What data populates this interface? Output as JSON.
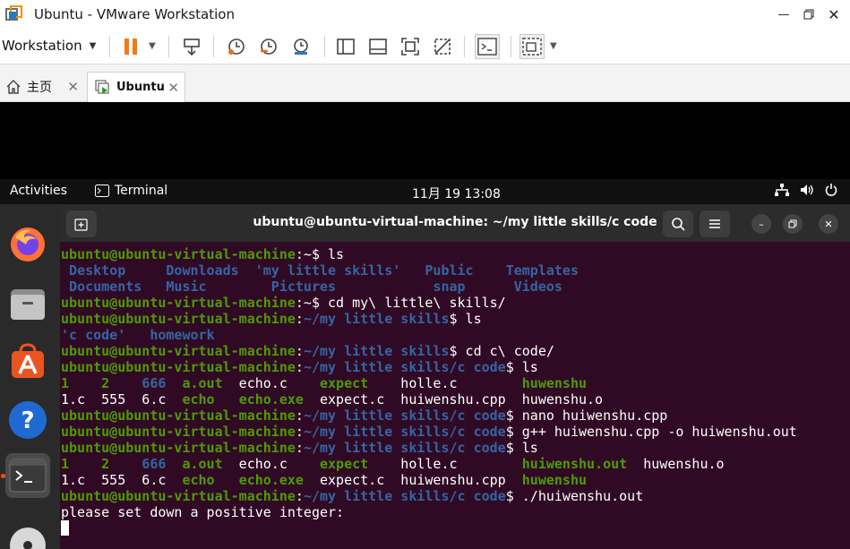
{
  "window": {
    "title": "Ubuntu - VMware Workstation"
  },
  "toolbar": {
    "menu_label": "Workstation"
  },
  "tabs": {
    "home_label": "主页",
    "vm_label": "Ubuntu"
  },
  "gnome": {
    "activities": "Activities",
    "app_name": "Terminal",
    "clock": "11月 19  13:08"
  },
  "terminal": {
    "title": "ubuntu@ubuntu-virtual-machine: ~/my little skills/c code",
    "prompt_user": "ubuntu@ubuntu-virtual-machine",
    "lines": [
      {
        "segs": [
          [
            "user",
            "ubuntu@ubuntu-virtual-machine"
          ],
          [
            "plain",
            ":~$ ls"
          ]
        ]
      },
      {
        "segs": [
          [
            "dir",
            " Desktop    "
          ],
          [
            "dir",
            " Downloads  "
          ],
          [
            "dir",
            "'my little skills'"
          ],
          [
            "plain",
            "   "
          ],
          [
            "dir",
            "Public"
          ],
          [
            "plain",
            "    "
          ],
          [
            "dir",
            "Templates"
          ]
        ]
      },
      {
        "segs": [
          [
            "dir",
            " Documents  "
          ],
          [
            "dir",
            " Music      "
          ],
          [
            "dir",
            "  Pictures"
          ],
          [
            "plain",
            "            "
          ],
          [
            "dir",
            "snap"
          ],
          [
            "plain",
            "      "
          ],
          [
            "dir",
            "Videos"
          ]
        ]
      },
      {
        "segs": [
          [
            "user",
            "ubuntu@ubuntu-virtual-machine"
          ],
          [
            "plain",
            ":~$ cd my\\ little\\ skills/"
          ]
        ]
      },
      {
        "segs": [
          [
            "user",
            "ubuntu@ubuntu-virtual-machine"
          ],
          [
            "plain",
            ":"
          ],
          [
            "path",
            "~/my little skills"
          ],
          [
            "plain",
            "$ ls"
          ]
        ]
      },
      {
        "segs": [
          [
            "dir",
            "'c code'"
          ],
          [
            "plain",
            "   "
          ],
          [
            "dir",
            "homework"
          ]
        ]
      },
      {
        "segs": [
          [
            "user",
            "ubuntu@ubuntu-virtual-machine"
          ],
          [
            "plain",
            ":"
          ],
          [
            "path",
            "~/my little skills"
          ],
          [
            "plain",
            "$ cd c\\ code/"
          ]
        ]
      },
      {
        "segs": [
          [
            "user",
            "ubuntu@ubuntu-virtual-machine"
          ],
          [
            "plain",
            ":"
          ],
          [
            "path",
            "~/my little skills/c code"
          ],
          [
            "plain",
            "$ ls"
          ]
        ]
      },
      {
        "segs": [
          [
            "exe",
            "1"
          ],
          [
            "plain",
            "    "
          ],
          [
            "exe",
            "2"
          ],
          [
            "plain",
            "    "
          ],
          [
            "dir",
            "666"
          ],
          [
            "plain",
            "  "
          ],
          [
            "exe",
            "a.out"
          ],
          [
            "plain",
            "  echo.c    "
          ],
          [
            "exe",
            "expect"
          ],
          [
            "plain",
            "    holle.c        "
          ],
          [
            "exe",
            "huwenshu"
          ]
        ]
      },
      {
        "segs": [
          [
            "plain",
            "1.c  555  6.c  "
          ],
          [
            "exe",
            "echo"
          ],
          [
            "plain",
            "   "
          ],
          [
            "exe",
            "echo.exe"
          ],
          [
            "plain",
            "  expect.c  huiwenshu.cpp  huwenshu.o"
          ]
        ]
      },
      {
        "segs": [
          [
            "user",
            "ubuntu@ubuntu-virtual-machine"
          ],
          [
            "plain",
            ":"
          ],
          [
            "path",
            "~/my little skills/c code"
          ],
          [
            "plain",
            "$ nano huiwenshu.cpp"
          ]
        ]
      },
      {
        "segs": [
          [
            "user",
            "ubuntu@ubuntu-virtual-machine"
          ],
          [
            "plain",
            ":"
          ],
          [
            "path",
            "~/my little skills/c code"
          ],
          [
            "plain",
            "$ g++ huiwenshu.cpp -o huiwenshu.out"
          ]
        ]
      },
      {
        "segs": [
          [
            "user",
            "ubuntu@ubuntu-virtual-machine"
          ],
          [
            "plain",
            ":"
          ],
          [
            "path",
            "~/my little skills/c code"
          ],
          [
            "plain",
            "$ ls"
          ]
        ]
      },
      {
        "segs": [
          [
            "exe",
            "1"
          ],
          [
            "plain",
            "    "
          ],
          [
            "exe",
            "2"
          ],
          [
            "plain",
            "    "
          ],
          [
            "dir",
            "666"
          ],
          [
            "plain",
            "  "
          ],
          [
            "exe",
            "a.out"
          ],
          [
            "plain",
            "  echo.c    "
          ],
          [
            "exe",
            "expect"
          ],
          [
            "plain",
            "    holle.c        "
          ],
          [
            "exe",
            "huiwenshu.out"
          ],
          [
            "plain",
            "  huwenshu.o"
          ]
        ]
      },
      {
        "segs": [
          [
            "plain",
            "1.c  555  6.c  "
          ],
          [
            "exe",
            "echo"
          ],
          [
            "plain",
            "   "
          ],
          [
            "exe",
            "echo.exe"
          ],
          [
            "plain",
            "  expect.c  huiwenshu.cpp  "
          ],
          [
            "exe",
            "huwenshu"
          ]
        ]
      },
      {
        "segs": [
          [
            "user",
            "ubuntu@ubuntu-virtual-machine"
          ],
          [
            "plain",
            ":"
          ],
          [
            "path",
            "~/my little skills/c code"
          ],
          [
            "plain",
            "$ ./huiwenshu.out"
          ]
        ]
      },
      {
        "segs": [
          [
            "plain",
            "please set down a positive integer:"
          ]
        ]
      }
    ]
  }
}
